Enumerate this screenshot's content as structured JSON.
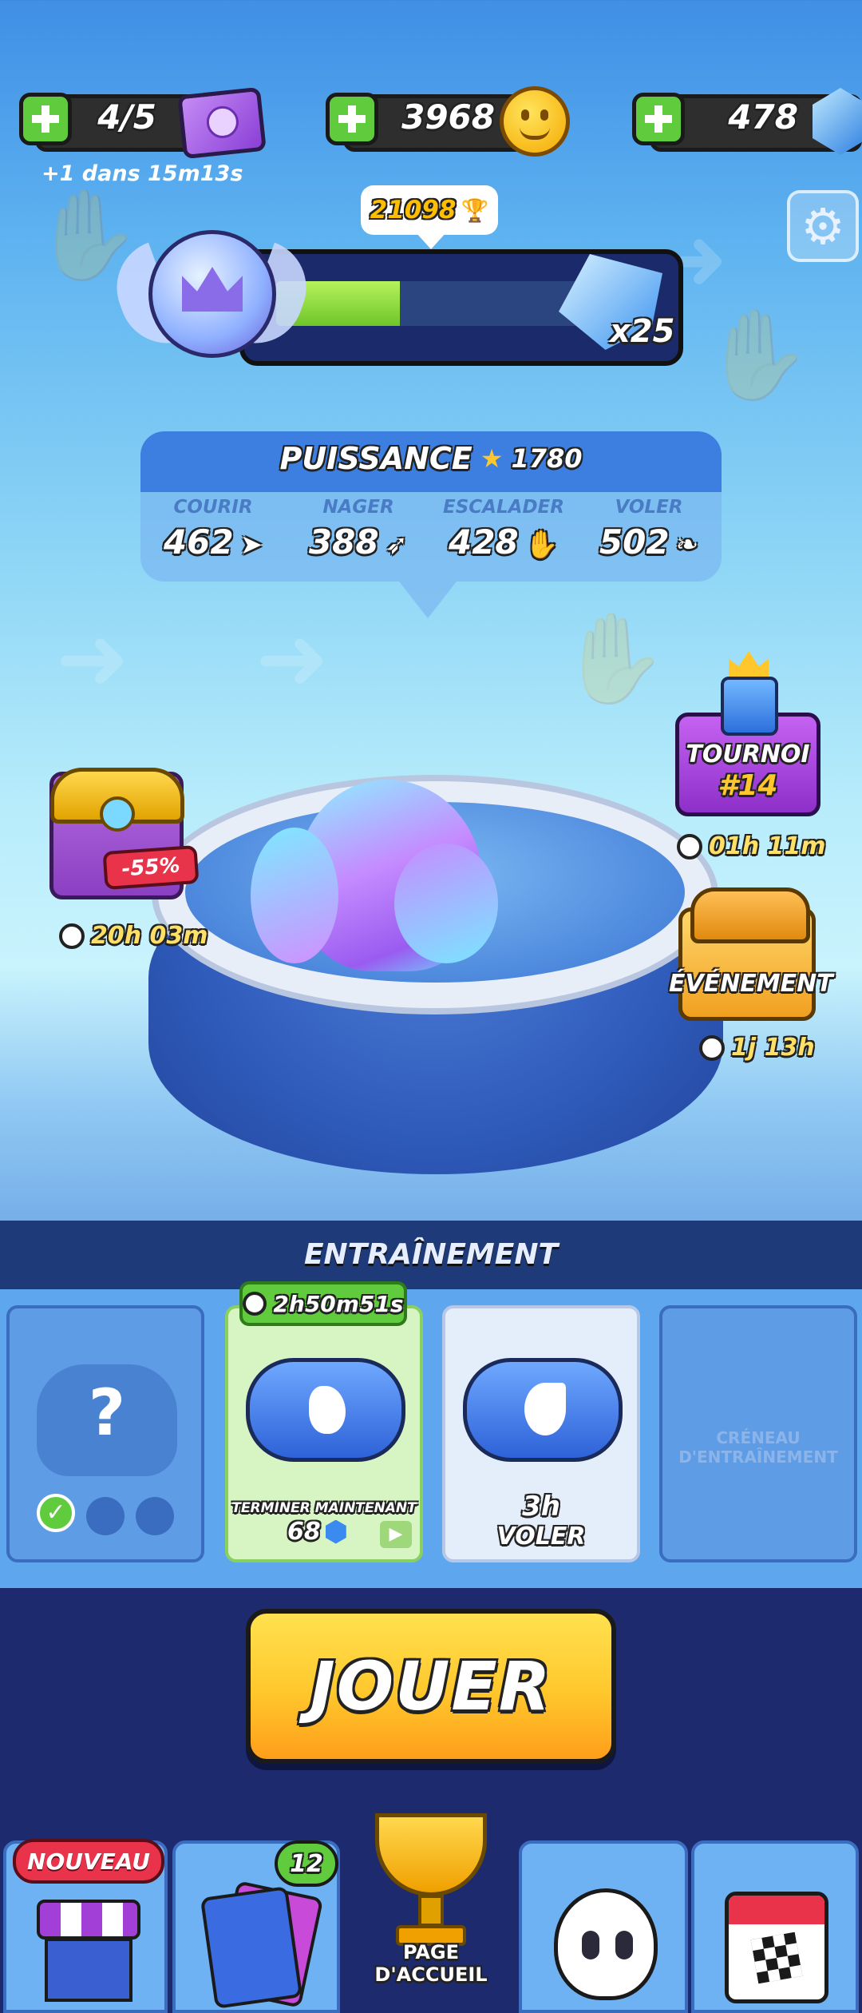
{
  "resources": {
    "tickets": {
      "value": "4/5",
      "refill": "+1 dans 15m13s"
    },
    "coins": {
      "value": "3968"
    },
    "gems": {
      "value": "478"
    }
  },
  "rank": {
    "trophies": "21098",
    "progress": 0.37,
    "reward_multiplier": "x25"
  },
  "power": {
    "title": "PUISSANCE",
    "total": "1780",
    "stats": [
      {
        "label": "COURIR",
        "value": "462"
      },
      {
        "label": "NAGER",
        "value": "388"
      },
      {
        "label": "ESCALADER",
        "value": "428"
      },
      {
        "label": "VOLER",
        "value": "502"
      }
    ]
  },
  "offers": {
    "chest": {
      "discount": "-55%",
      "timer": "20h 03m"
    },
    "tournament": {
      "title": "TOURNOI",
      "number": "#14",
      "timer": "01h 11m"
    },
    "event": {
      "title": "ÉVÉNEMENT",
      "timer": "1j 13h"
    }
  },
  "training": {
    "title": "ENTRAÎNEMENT",
    "slots": [
      {
        "type": "locked",
        "symbol": "?"
      },
      {
        "type": "active",
        "timer": "2h50m51s",
        "finish_label": "TERMINER MAINTENANT",
        "cost": "68"
      },
      {
        "type": "available",
        "duration": "3h",
        "skill": "VOLER"
      },
      {
        "type": "empty",
        "label": "CRÉNEAU D'ENTRAÎNEMENT"
      }
    ]
  },
  "play_button": {
    "label": "JOUER"
  },
  "bottom_nav": {
    "shop_badge": "NOUVEAU",
    "cards_count": "12",
    "home_label": "PAGE D'ACCUEIL"
  },
  "colors": {
    "accent_yellow": "#ffc72c",
    "accent_green": "#5fcb3d",
    "purple": "#a23fd6",
    "navy": "#1d2b6e"
  }
}
